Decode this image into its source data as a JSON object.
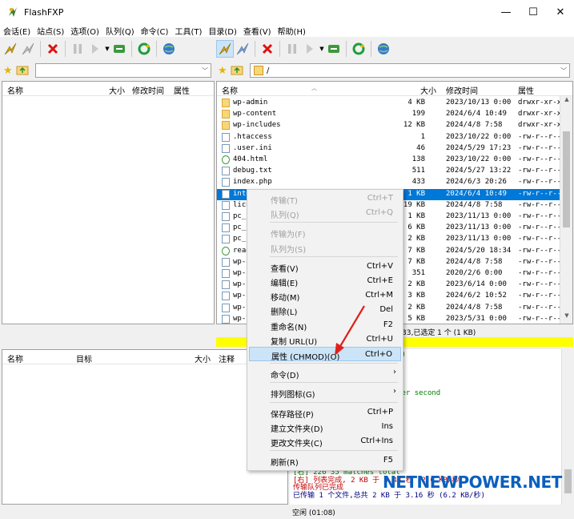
{
  "window": {
    "title": "FlashFXP",
    "minimize": "—",
    "maximize": "☐",
    "close": "✕"
  },
  "menu": [
    "会话(E)",
    "站点(S)",
    "选项(O)",
    "队列(Q)",
    "命令(C)",
    "工具(T)",
    "目录(D)",
    "查看(V)",
    "帮助(H)"
  ],
  "icons": {
    "connect": "lightning-connect-icon",
    "disconnect": "disconnect-icon",
    "abort": "red-x-icon",
    "pause": "pause-icon",
    "transfer": "transfer-icon",
    "refresh": "refresh-icon",
    "globe": "globe-icon",
    "star": "star-icon",
    "folder-up": "folder-up-icon"
  },
  "colors": {
    "selection": "#0078d7",
    "highlight_bar": "#ffff00",
    "log_green": "#008000",
    "log_blue": "#000080",
    "log_red": "#c00000",
    "menu_hover": "#cce4f7",
    "arrow": "#e0201b",
    "watermark": "#0a5fbf"
  },
  "local": {
    "path": "",
    "columns": {
      "name": "名称",
      "size": "大小",
      "modified": "修改时间",
      "attr": "属性"
    }
  },
  "remote": {
    "path": "/",
    "columns": {
      "name": "名称",
      "size": "大小",
      "modified": "修改时间",
      "attr": "属性"
    },
    "files": [
      {
        "name": "wp-admin",
        "size": "4 KB",
        "date": "2023/10/13 0:00",
        "attr": "drwxr-xr-x",
        "type": "folder"
      },
      {
        "name": "wp-content",
        "size": "199",
        "date": "2024/6/4 10:49",
        "attr": "drwxr-xr-x",
        "type": "folder"
      },
      {
        "name": "wp-includes",
        "size": "12 KB",
        "date": "2024/4/8 7:58",
        "attr": "drwxr-xr-x",
        "type": "folder"
      },
      {
        "name": ".htaccess",
        "size": "1",
        "date": "2023/10/22 0:00",
        "attr": "-rw-r--r--",
        "type": "file"
      },
      {
        "name": ".user.ini",
        "size": "46",
        "date": "2024/5/29 17:23",
        "attr": "-rw-r--r--",
        "type": "file"
      },
      {
        "name": "404.html",
        "size": "138",
        "date": "2023/10/22 0:00",
        "attr": "-rw-r--r--",
        "type": "web"
      },
      {
        "name": "debug.txt",
        "size": "511",
        "date": "2024/5/27 13:22",
        "attr": "-rw-r--r--",
        "type": "file"
      },
      {
        "name": "index.php",
        "size": "433",
        "date": "2024/6/3 20:26",
        "attr": "-rw-r--r--",
        "type": "file"
      },
      {
        "name": "inte",
        "size": "1 KB",
        "date": "2024/6/4 10:49",
        "attr": "-rw-r--r--",
        "type": "file",
        "selected": true
      },
      {
        "name": "lice",
        "size": "19 KB",
        "date": "2024/4/8 7:58",
        "attr": "-rw-r--r--",
        "type": "file"
      },
      {
        "name": "pc_r",
        "size": "1 KB",
        "date": "2023/11/13 0:00",
        "attr": "-rw-r--r--",
        "type": "file"
      },
      {
        "name": "pc_r",
        "size": "6 KB",
        "date": "2023/11/13 0:00",
        "attr": "-rw-r--r--",
        "type": "file"
      },
      {
        "name": "pc_r",
        "size": "2 KB",
        "date": "2023/11/13 0:00",
        "attr": "-rw-r--r--",
        "type": "file"
      },
      {
        "name": "read",
        "size": "7 KB",
        "date": "2024/5/20 18:34",
        "attr": "-rw-r--r--",
        "type": "web"
      },
      {
        "name": "wp-a",
        "size": "7 KB",
        "date": "2024/4/8 7:58",
        "attr": "-rw-r--r--",
        "type": "file"
      },
      {
        "name": "wp-b",
        "size": "351",
        "date": "2020/2/6 0:00",
        "attr": "-rw-r--r--",
        "type": "file"
      },
      {
        "name": "wp-c",
        "size": "2 KB",
        "date": "2023/6/14 0:00",
        "attr": "-rw-r--r--",
        "type": "file"
      },
      {
        "name": "wp-c",
        "size": "3 KB",
        "date": "2024/6/2 10:52",
        "attr": "-rw-r--r--",
        "type": "file"
      },
      {
        "name": "wp-c",
        "size": "2 KB",
        "date": "2024/4/8 7:58",
        "attr": "-rw-r--r--",
        "type": "file"
      },
      {
        "name": "wp-c",
        "size": "5 KB",
        "date": "2023/5/31 0:00",
        "attr": "-rw-r--r--",
        "type": "file"
      }
    ],
    "status": "33,已选定 1 个 (1 KB)"
  },
  "queue": {
    "columns": {
      "name": "名称",
      "target": "目标",
      "size": "大小",
      "note": "注释"
    }
  },
  "log": [
    {
      "text": "de (37,114,55,215,153,122)",
      "color": "green"
    },
    {
      "text": ".114.55.215 端口: 39290",
      "color": "blue"
    },
    {
      "text": "",
      "color": "green"
    },
    {
      "text": "ction",
      "color": "green"
    },
    {
      "text": "ransferred",
      "color": "green"
    },
    {
      "text": "ured here), 6.33 Kbytes per second",
      "color": "green"
    },
    {
      "text": "= 0.33 秒 (6.2 KB/秒)",
      "color": "blue"
    },
    {
      "text": "",
      "color": "green"
    },
    {
      "text": "",
      "color": "green"
    },
    {
      "text": "de (37,114,55,215,154,39)",
      "color": "green"
    },
    {
      "text": ".114.55.215 端口: 39463",
      "color": "blue"
    },
    {
      "text": "",
      "color": "green"
    },
    {
      "text": "ction",
      "color": "green"
    },
    {
      "text": "",
      "color": "green"
    },
    {
      "text": "",
      "color": "green"
    },
    {
      "text": "[右] 226 35 matches total",
      "color": "green"
    },
    {
      "text": "[右] 列表完成, 2 KB 于 0.48 秒 (2.0 KB/秒)",
      "color": "red"
    },
    {
      "text": "传输队列已完成",
      "color": "red"
    },
    {
      "text": "已传输 1 个文件,总共 2 KB 于 3.16 秒 (6.2 KB/秒)",
      "color": "blue"
    }
  ],
  "footer": {
    "status": "空闲 (01:08)"
  },
  "context_menu": [
    {
      "label": "传输(T)",
      "key": "Ctrl+T",
      "disabled": true
    },
    {
      "label": "队列(Q)",
      "key": "Ctrl+Q",
      "disabled": true
    },
    {
      "sep": true
    },
    {
      "label": "传输为(F)",
      "key": "",
      "disabled": true
    },
    {
      "label": "队列为(S)",
      "key": "",
      "disabled": true
    },
    {
      "sep": true
    },
    {
      "label": "查看(V)",
      "key": "Ctrl+V"
    },
    {
      "label": "编辑(E)",
      "key": "Ctrl+E"
    },
    {
      "label": "移动(M)",
      "key": "Ctrl+M"
    },
    {
      "label": "删除(L)",
      "key": "Del"
    },
    {
      "label": "重命名(N)",
      "key": "F2"
    },
    {
      "label": "复制 URL(U)",
      "key": "Ctrl+U"
    },
    {
      "label": "属性 (CHMOD)(O)",
      "key": "Ctrl+O",
      "highlight": true
    },
    {
      "sep": true
    },
    {
      "label": "命令(D)",
      "key": "",
      "submenu": true
    },
    {
      "sep": true
    },
    {
      "label": "排列图标(G)",
      "key": "",
      "submenu": true
    },
    {
      "sep": true
    },
    {
      "label": "保存路径(P)",
      "key": "Ctrl+P"
    },
    {
      "label": "建立文件夹(D)",
      "key": "Ins"
    },
    {
      "label": "更改文件夹(C)",
      "key": "Ctrl+Ins"
    },
    {
      "sep": true
    },
    {
      "label": "刷新(R)",
      "key": "F5"
    }
  ],
  "watermark": "NETNEWPOWER.NET"
}
